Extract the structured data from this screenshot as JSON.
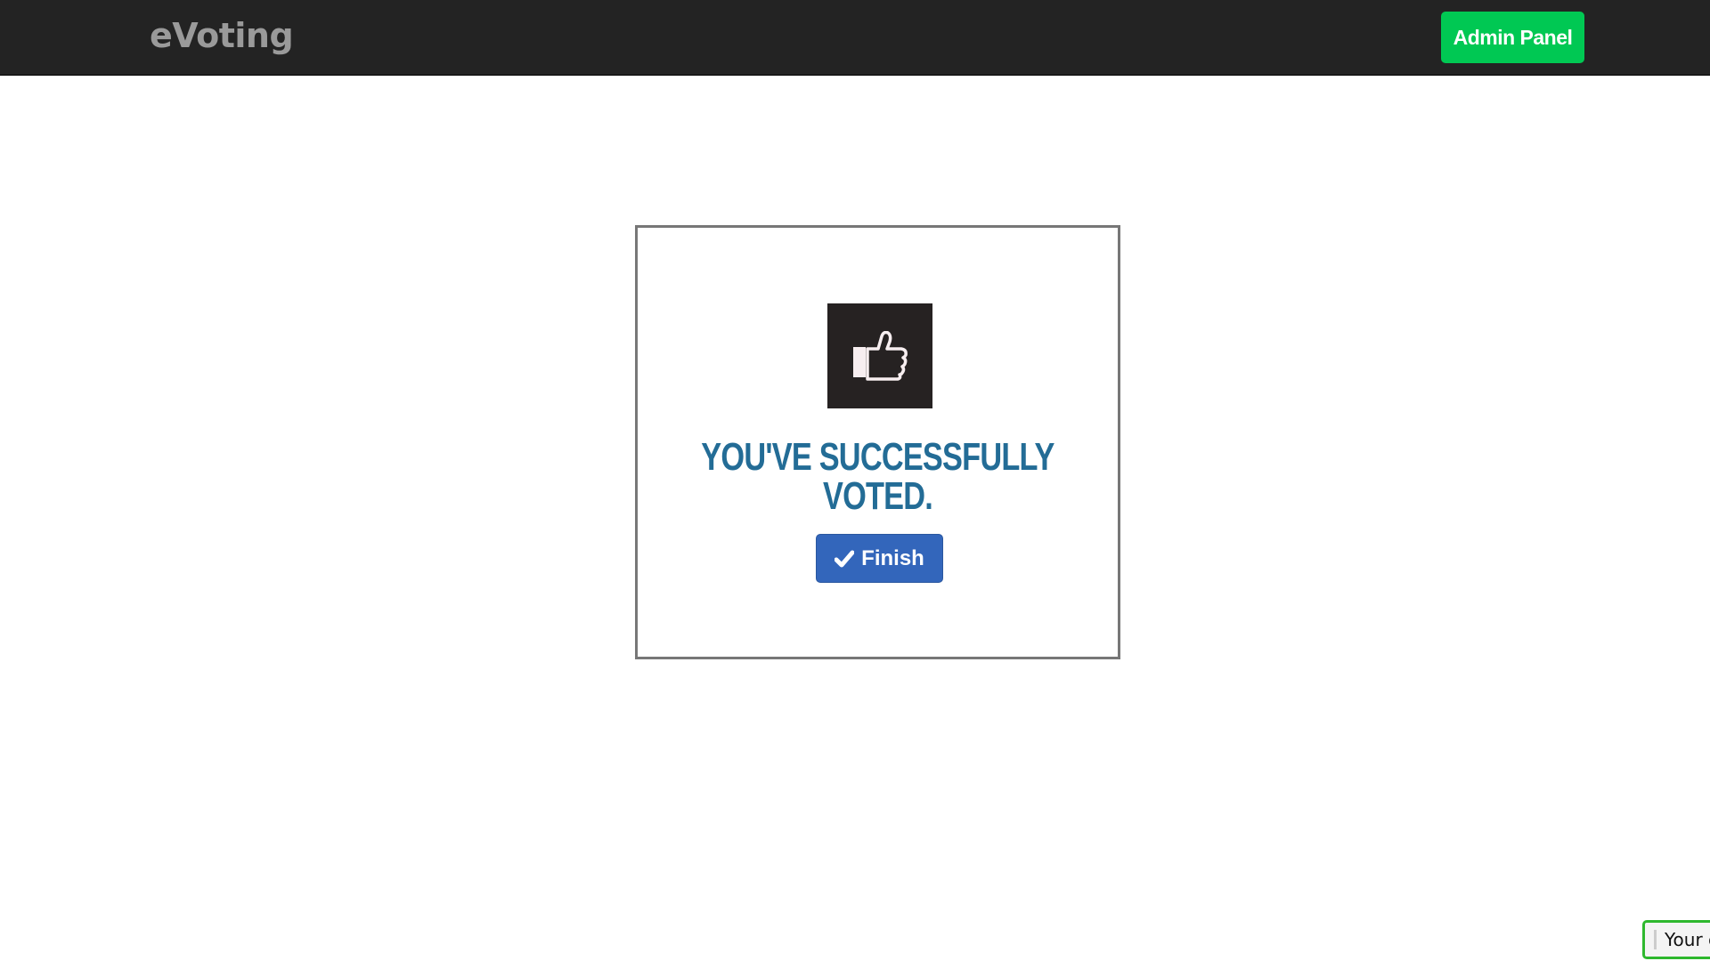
{
  "navbar": {
    "brand": "eVoting",
    "admin_button_label": "Admin Panel",
    "admin_button_color": "#00c853",
    "background_color": "#232323"
  },
  "card": {
    "icon": "thumbs-up-icon",
    "headline_line1": "YOU'VE SUCCESSFULLY",
    "headline_line2": "VOTED.",
    "headline_color": "#236c96",
    "finish_button_label": "Finish",
    "finish_button_icon": "checkmark-icon",
    "finish_button_color": "#3366bb"
  },
  "toast": {
    "text": "Your c",
    "border_color": "#2eb82e"
  }
}
